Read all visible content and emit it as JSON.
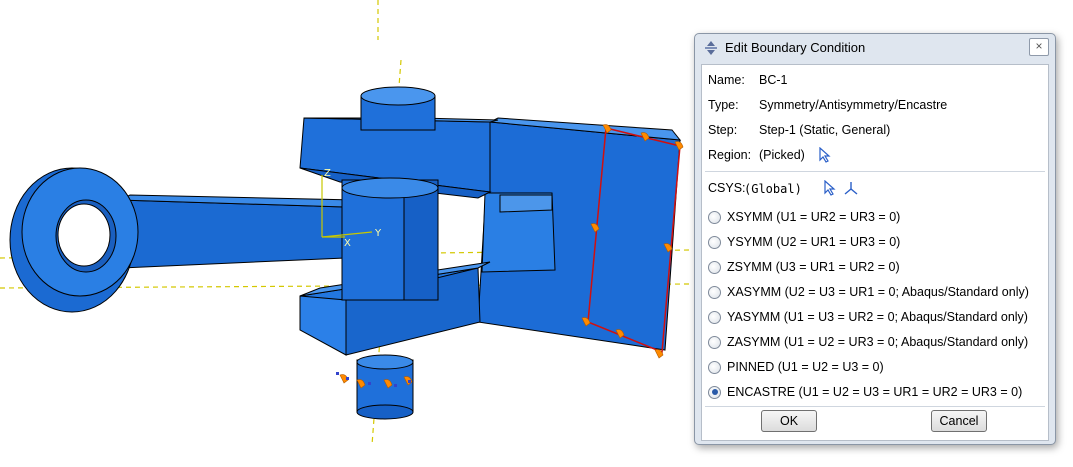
{
  "viewport": {
    "triad_labels": {
      "z": "Z",
      "x": "X",
      "y": "Y"
    }
  },
  "dialog": {
    "title": "Edit Boundary Condition",
    "close_glyph": "×",
    "name_label": "Name:",
    "name_value": "BC-1",
    "type_label": "Type:",
    "type_value": "Symmetry/Antisymmetry/Encastre",
    "step_label": "Step:",
    "step_value": "Step-1 (Static, General)",
    "region_label": "Region:",
    "region_value": "(Picked)",
    "csys_label": "CSYS:",
    "csys_value": "(Global)",
    "options": [
      {
        "label": "XSYMM (U1 = UR2 = UR3 = 0)",
        "checked": false
      },
      {
        "label": "YSYMM (U2 = UR1 = UR3 = 0)",
        "checked": false
      },
      {
        "label": "ZSYMM (U3 = UR1 = UR2 = 0)",
        "checked": false
      },
      {
        "label": "XASYMM (U2 = U3 = UR1 = 0; Abaqus/Standard only)",
        "checked": false
      },
      {
        "label": "YASYMM (U1 = U3 = UR2 = 0; Abaqus/Standard only)",
        "checked": false
      },
      {
        "label": "ZASYMM (U1 = U2 = UR3 = 0; Abaqus/Standard only)",
        "checked": false
      },
      {
        "label": "PINNED (U1 = U2 = U3 = 0)",
        "checked": false
      },
      {
        "label": "ENCASTRE (U1 = U2 = U3 = UR1 = UR2 = UR3 = 0)",
        "checked": true
      }
    ],
    "ok_label": "OK",
    "cancel_label": "Cancel"
  },
  "icons": {
    "title": "move-dialog-icon",
    "region_pick": "cursor-arrow-icon",
    "csys_pick": "cursor-arrow-icon",
    "csys_create": "datum-csys-icon"
  },
  "colors": {
    "model_face": "#1e73dc",
    "model_edge": "#000000",
    "bc_marker": "#ff8a00",
    "highlight_edge": "#d01010",
    "datum_line": "#d4c800",
    "dialog_bg": "#dfe6ef"
  }
}
